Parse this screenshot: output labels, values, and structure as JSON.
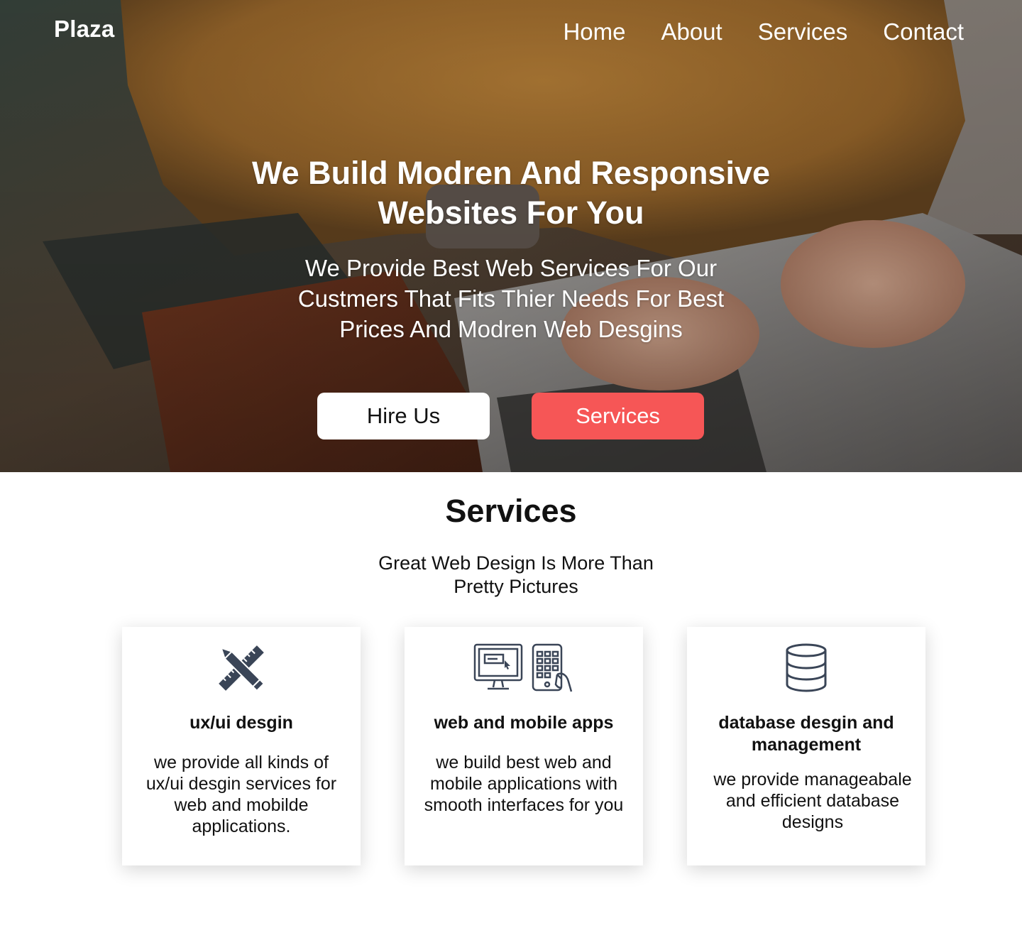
{
  "header": {
    "brand": "Plaza",
    "nav": [
      {
        "label": "Home"
      },
      {
        "label": "About"
      },
      {
        "label": "Services"
      },
      {
        "label": "Contact"
      }
    ]
  },
  "hero": {
    "title": "We Build Modren And Responsive Websites For You",
    "subtitle": "We Provide Best Web Services For Our Custmers That Fits Thier Needs For Best Prices And Modren Web Desgins",
    "buttons": {
      "hire_label": "Hire Us",
      "services_label": "Services"
    }
  },
  "services": {
    "title": "Services",
    "subtitle": "Great Web Design Is More Than Pretty Pictures",
    "cards": [
      {
        "icon": "pencil-ruler-icon",
        "title": "ux/ui desgin",
        "text": "we provide all kinds of ux/ui desgin services for web and mobilde applications."
      },
      {
        "icon": "devices-icon",
        "title": "web and mobile apps",
        "text": "we build best web and mobile applications with smooth interfaces for you"
      },
      {
        "icon": "database-icon",
        "title": "database desgin and management",
        "text": "we provide manageabale and efficient database designs"
      }
    ]
  },
  "colors": {
    "accent": "#f65656",
    "icon": "#3a4557",
    "text": "#111111",
    "hero_text": "#ffffff"
  }
}
